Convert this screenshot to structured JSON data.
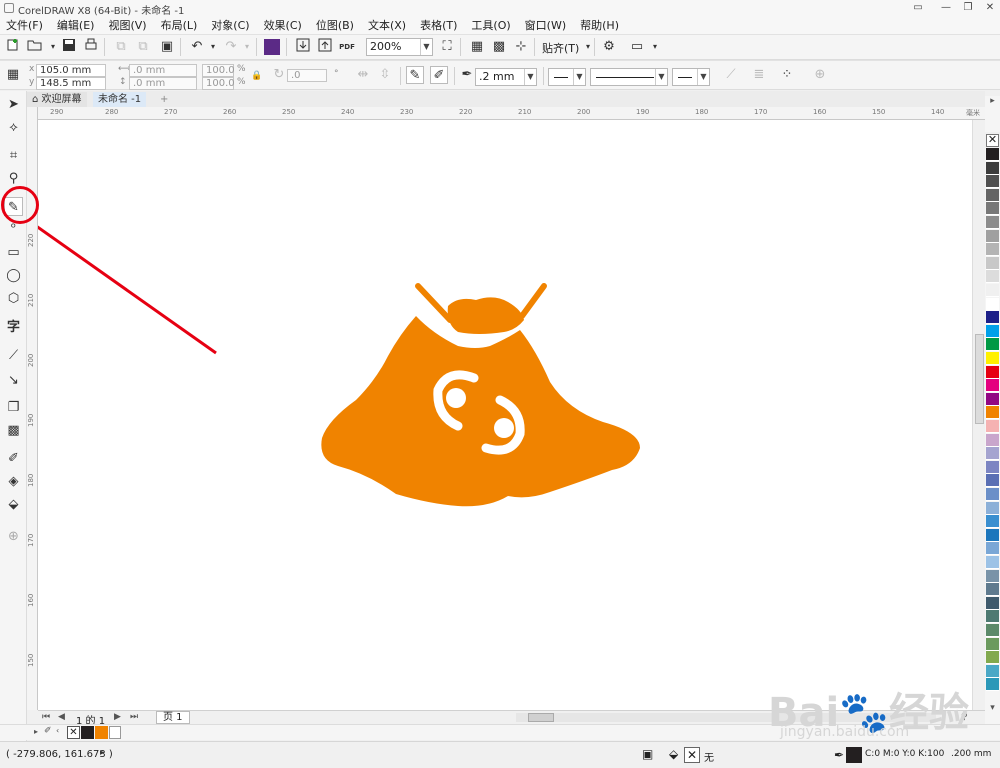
{
  "window": {
    "title": "CorelDRAW X8 (64-Bit) - 未命名 -1",
    "controls": [
      "▭",
      "—",
      "❐",
      "✕"
    ]
  },
  "menu": [
    "文件(F)",
    "编辑(E)",
    "视图(V)",
    "布局(L)",
    "对象(C)",
    "效果(C)",
    "位图(B)",
    "文本(X)",
    "表格(T)",
    "工具(O)",
    "窗口(W)",
    "帮助(H)"
  ],
  "standard_toolbar": {
    "zoom": "200%",
    "snap_label": "贴齐(T)",
    "pdf_label": "PDF"
  },
  "property_bar": {
    "x": "105.0 mm",
    "y": "148.5 mm",
    "width": ".0 mm",
    "height": ".0 mm",
    "scale_x": "100.0",
    "scale_y": "100.0",
    "percent": "%",
    "rotation": ".0",
    "outline_width": ".2 mm"
  },
  "doc_tabs": [
    {
      "label": "欢迎屏幕",
      "active": false
    },
    {
      "label": "未命名 -1",
      "active": true
    }
  ],
  "ruler": {
    "horizontal": [
      "290",
      "280",
      "270",
      "260",
      "250",
      "240",
      "230",
      "220",
      "210",
      "200",
      "190",
      "180",
      "170",
      "160",
      "150",
      "140"
    ],
    "vertical": [
      "220",
      "210",
      "200",
      "190",
      "180",
      "170",
      "160",
      "150"
    ],
    "unit": "毫米"
  },
  "page_nav": {
    "page_count": "1 的 1",
    "page_tab": "页 1"
  },
  "palette_colors": [
    "#231f20",
    "#3c3c3c",
    "#505050",
    "#646464",
    "#787878",
    "#8c8c8c",
    "#a0a0a0",
    "#b4b4b4",
    "#c8c8c8",
    "#dcdcdc",
    "#f0f0f0",
    "#ffffff",
    "#1d2088",
    "#00a0e9",
    "#009944",
    "#fff100",
    "#e60012",
    "#e4007f",
    "#920783",
    "#f08300",
    "#f5b2b2",
    "#c9a6cc",
    "#a5a4d0",
    "#7c85c2",
    "#5a6fb4",
    "#6b8fc8",
    "#8cb0d8",
    "#3a8fd0",
    "#1c76bc",
    "#7aa7d6",
    "#9cc2e6",
    "#7993a8",
    "#5f7a8e",
    "#3f5a6c",
    "#4e7a72",
    "#5c8a6a",
    "#6b9a5e",
    "#82a94e",
    "#4aa8c6",
    "#2b98b8"
  ],
  "doc_palette": [
    "none",
    "#231f20",
    "#f08300",
    "#ffffff"
  ],
  "status": {
    "coords": "( -279.806, 161.673 )",
    "fill_none": "无",
    "outline_color": "C:0 M:0 Y:0 K:100",
    "outline_width": ".200 mm"
  },
  "drawing": {
    "fill_color": "#f08300",
    "symbol": "♋"
  },
  "annotation": {
    "color": "#e60012"
  },
  "watermark": {
    "brand": "Bai",
    "brand_tail": "经验",
    "url": "jingyan.baidu.com"
  }
}
